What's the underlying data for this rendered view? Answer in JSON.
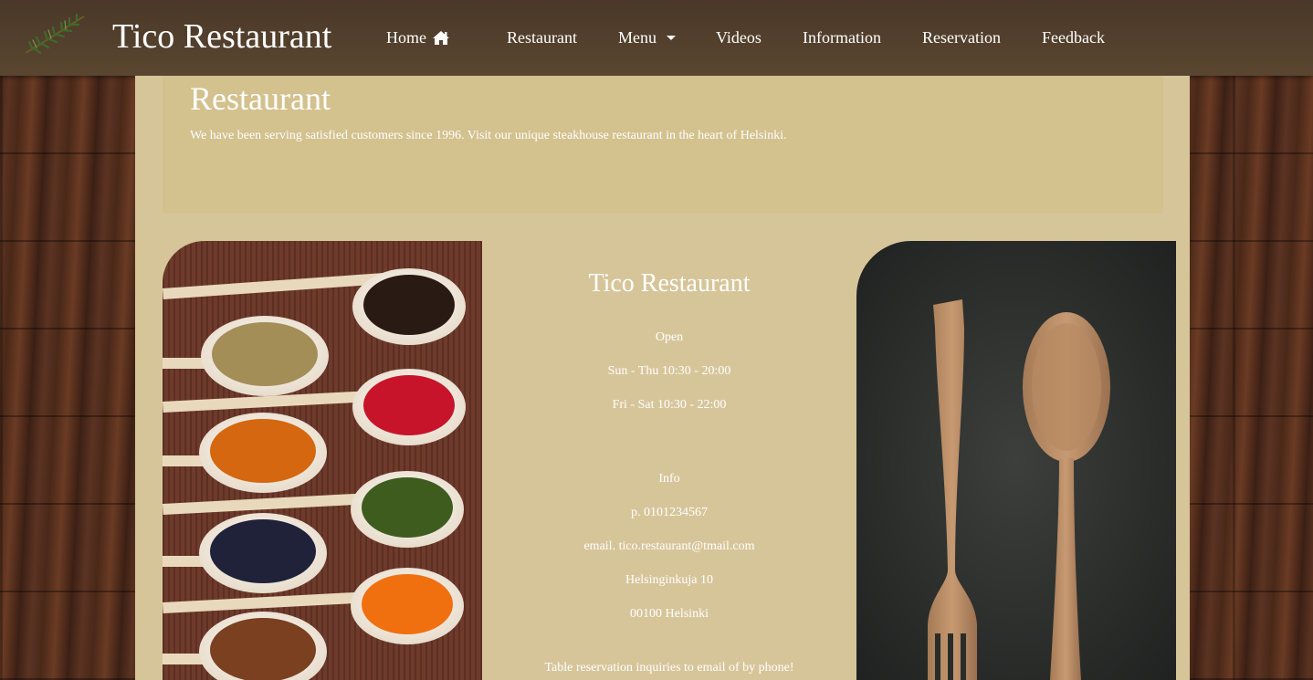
{
  "navbar": {
    "brand": "Tico Restaurant",
    "logo_icon": "rosemary-logo",
    "items": [
      {
        "label": "Home",
        "icon": "home-icon"
      },
      {
        "label": "Restaurant"
      },
      {
        "label": "Menu",
        "icon": "caret-down-icon"
      },
      {
        "label": "Videos"
      },
      {
        "label": "Information"
      },
      {
        "label": "Reservation"
      },
      {
        "label": "Feedback"
      }
    ]
  },
  "jumbotron": {
    "title": "Restaurant",
    "text": "We have been serving satisfied customers since 1996. Visit our unique steakhouse restaurant in the heart of Helsinki."
  },
  "info": {
    "name": "Tico Restaurant",
    "open_label": "Open",
    "hours": [
      "Sun - Thu 10:30 - 20:00",
      "Fri - Sat 10:30 - 22:00"
    ],
    "info_label": "Info",
    "phone": "p. 0101234567",
    "email": "email. tico.restaurant@tmail.com",
    "street": "Helsinginkuja 10",
    "city": "00100 Helsinki",
    "reservation_note": "Table reservation inquiries to email of by phone!"
  },
  "images": {
    "left": "spices-in-wooden-spoons-image",
    "right": "wooden-fork-and-spoon-image"
  },
  "colors": {
    "navbar": "#4f3c2b",
    "container": "#d7c59a",
    "jumbotron": "#d3c18e",
    "text": "#ffffff"
  }
}
